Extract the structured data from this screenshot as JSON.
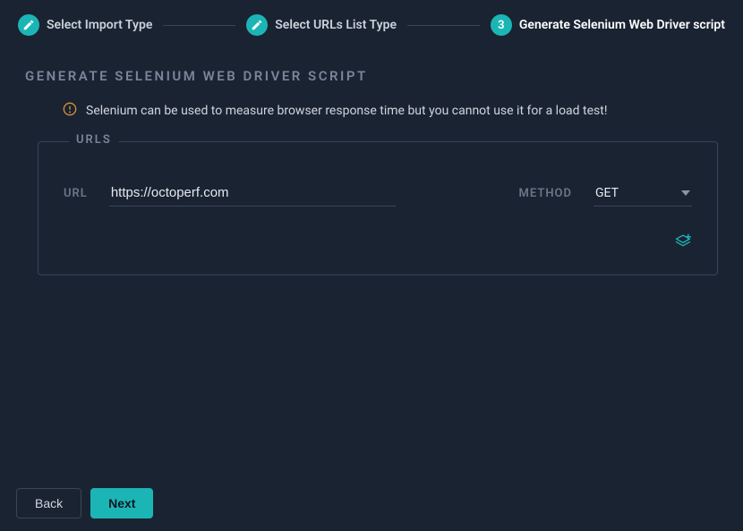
{
  "stepper": {
    "steps": [
      {
        "label": "Select Import Type",
        "completed": true
      },
      {
        "label": "Select URLs List Type",
        "completed": true
      },
      {
        "label": "Generate Selenium Web Driver script",
        "number": "3",
        "active": true
      }
    ]
  },
  "heading": "GENERATE SELENIUM WEB DRIVER SCRIPT",
  "info_banner": "Selenium can be used to measure browser response time but you cannot use it for a load test!",
  "urls_section": {
    "legend": "URLS",
    "url_label": "URL",
    "url_value": "https://octoperf.com",
    "method_label": "METHOD",
    "method_value": "GET"
  },
  "footer": {
    "back_label": "Back",
    "next_label": "Next"
  },
  "colors": {
    "accent": "#1cb5b5",
    "background": "#1a2332",
    "border": "#36465c",
    "text_muted": "#7a8599"
  }
}
